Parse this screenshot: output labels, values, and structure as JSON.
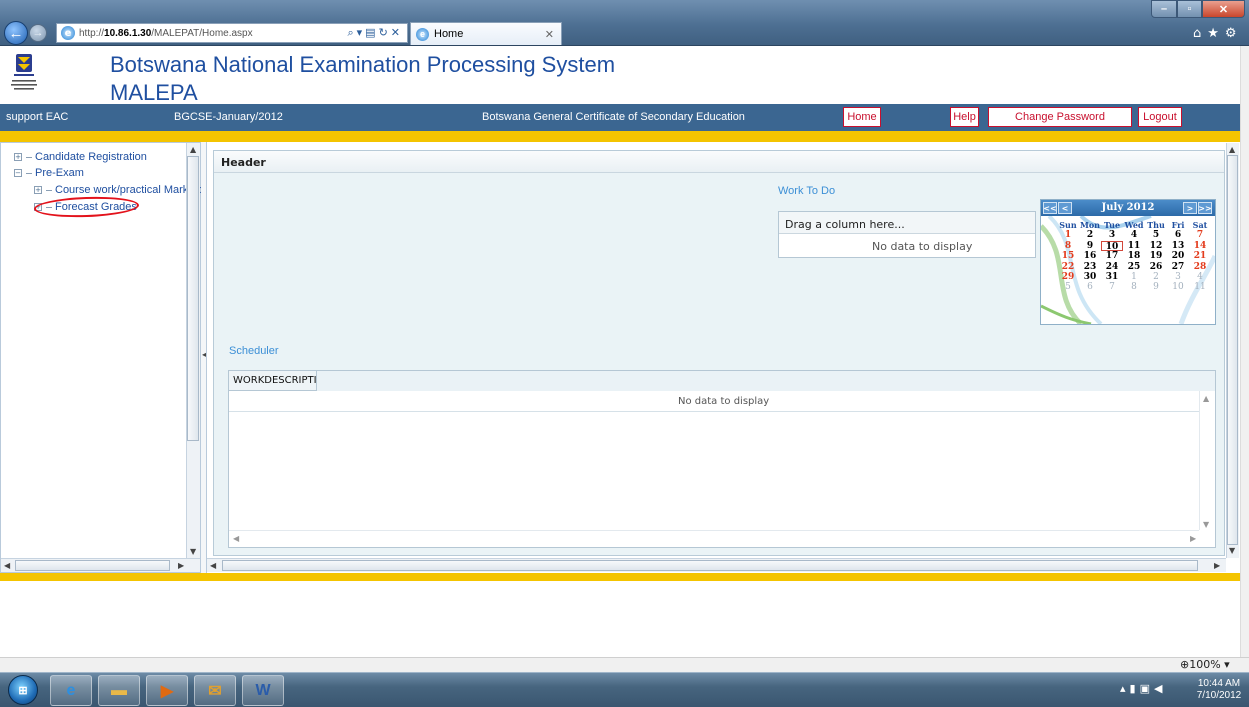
{
  "browser": {
    "url_prefix": "http://",
    "url_host": "10.86.1.30",
    "url_path": "/MALEPAT/Home.aspx",
    "tab_title": "Home",
    "zoom": "100%"
  },
  "app": {
    "title": "Botswana National Examination Processing System",
    "subtitle": "MALEPA"
  },
  "navbar": {
    "user": "support EAC",
    "session": "BGCSE-January/2012",
    "program": "Botswana General Certificate of Secondary Education",
    "home": "Home",
    "help": "Help",
    "change_password": "Change Password",
    "logout": "Logout"
  },
  "tree": {
    "items": [
      {
        "label": "Candidate Registration"
      },
      {
        "label": "Pre-Exam"
      },
      {
        "label": "Course work/practical Marks cap"
      },
      {
        "label": "Forecast Grades"
      }
    ]
  },
  "main": {
    "header": "Header",
    "work_to_do": "Work To Do",
    "drag_hint": "Drag a column here...",
    "no_data": "No data to display",
    "scheduler": "Scheduler",
    "scheduler_column": "WORKDESCRIPTION",
    "scheduler_no_data": "No data to display"
  },
  "calendar": {
    "title": "July 2012",
    "nav_prev_year": "<<",
    "nav_prev": "<",
    "nav_next": ">",
    "nav_next_year": ">>",
    "days_of_week": [
      "Sun",
      "Mon",
      "Tue",
      "Wed",
      "Thu",
      "Fri",
      "Sat"
    ],
    "weeks": [
      [
        "1",
        "2",
        "3",
        "4",
        "5",
        "6",
        "7"
      ],
      [
        "8",
        "9",
        "10",
        "11",
        "12",
        "13",
        "14"
      ],
      [
        "15",
        "16",
        "17",
        "18",
        "19",
        "20",
        "21"
      ],
      [
        "22",
        "23",
        "24",
        "25",
        "26",
        "27",
        "28"
      ],
      [
        "29",
        "30",
        "31",
        "1",
        "2",
        "3",
        "4"
      ],
      [
        "5",
        "6",
        "7",
        "8",
        "9",
        "10",
        "11"
      ]
    ],
    "selected": "10"
  },
  "taskbar": {
    "time": "10:44 AM",
    "date": "7/10/2012"
  },
  "colors": {
    "navbar": "#3b6691",
    "gold": "#f4c400",
    "title": "#1f4fa0",
    "link": "#3c8fd6",
    "annotation": "#e3121b"
  }
}
